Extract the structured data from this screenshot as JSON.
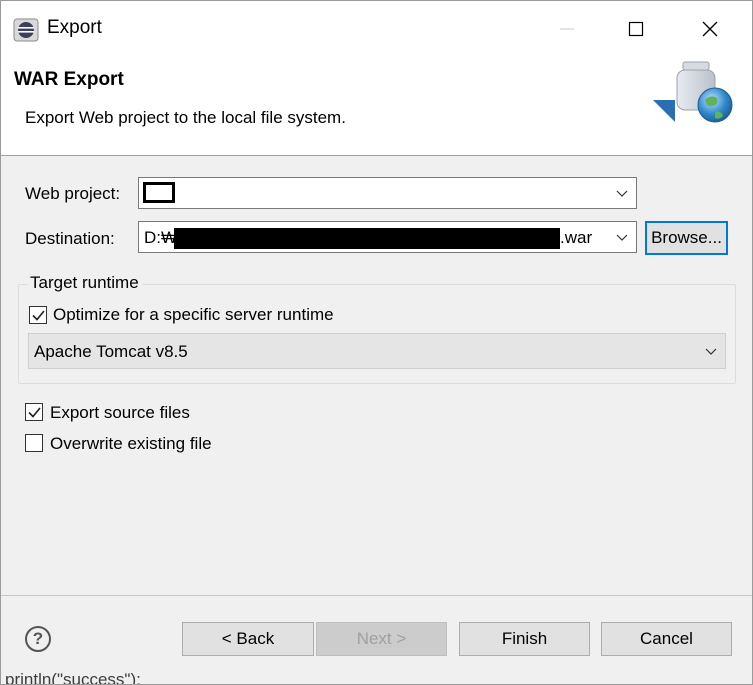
{
  "window": {
    "title": "Export"
  },
  "banner": {
    "title": "WAR Export",
    "description": "Export Web project to the local file system."
  },
  "form": {
    "web_project_label": "Web project:",
    "destination_label": "Destination:",
    "destination_prefix": "D:₩",
    "destination_suffix": ".war",
    "browse_label": "Browse..."
  },
  "target_runtime": {
    "group_title": "Target runtime",
    "optimize_label": "Optimize for a specific server runtime",
    "optimize_checked": true,
    "runtime_value": "Apache Tomcat v8.5"
  },
  "options": {
    "export_source_label": "Export source files",
    "export_source_checked": true,
    "overwrite_label": "Overwrite existing file",
    "overwrite_checked": false
  },
  "buttons": {
    "help": "?",
    "back": "< Back",
    "next": "Next >",
    "finish": "Finish",
    "cancel": "Cancel"
  },
  "background": {
    "code_fragment": "println(\"success\");"
  },
  "colors": {
    "focus_border": "#0078d7",
    "window_bg": "#f0f0f0"
  }
}
